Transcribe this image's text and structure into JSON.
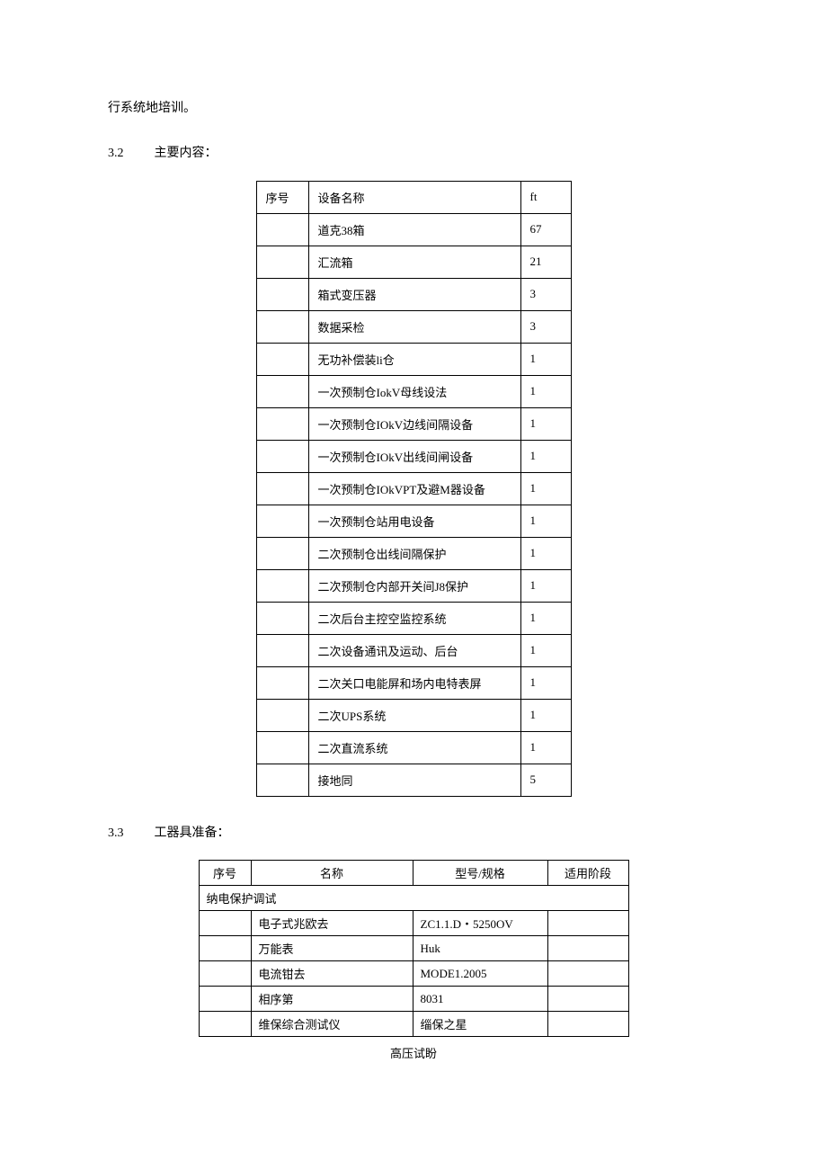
{
  "intro": "行系统地培训。",
  "section32": {
    "num": "3.2",
    "title": "主要内容："
  },
  "table1": {
    "headers": {
      "c1": "序号",
      "c2": "设备名称",
      "c3": "ft"
    },
    "rows": [
      {
        "c1": "",
        "c2": "道克38箱",
        "c3": "67"
      },
      {
        "c1": "",
        "c2": "汇流箱",
        "c3": "21"
      },
      {
        "c1": "",
        "c2": "箱式变压器",
        "c3": "3"
      },
      {
        "c1": "",
        "c2": "数据采检",
        "c3": "3"
      },
      {
        "c1": "",
        "c2": "无功补偿装li仓",
        "c3": "1"
      },
      {
        "c1": "",
        "c2": "一次预制仓IokV母线设法",
        "c3": "1"
      },
      {
        "c1": "",
        "c2": "一次预制仓IOkV边线间隔设备",
        "c3": "1"
      },
      {
        "c1": "",
        "c2": "一次预制仓IOkV出线间闸设备",
        "c3": "1"
      },
      {
        "c1": "",
        "c2": "一次预制仓IOkVPT及避M器设备",
        "c3": "1"
      },
      {
        "c1": "",
        "c2": "一次预制仓站用电设备",
        "c3": "1"
      },
      {
        "c1": "",
        "c2": "二次预制仓出线间隔保护",
        "c3": "1"
      },
      {
        "c1": "",
        "c2": "二次预制仓内部开关间J8保护",
        "c3": "1"
      },
      {
        "c1": "",
        "c2": "二次后台主控空监控系统",
        "c3": "1"
      },
      {
        "c1": "",
        "c2": "二次设备通讯及运动、后台",
        "c3": "1"
      },
      {
        "c1": "",
        "c2": "二次关口电能屏和场内电特表屏",
        "c3": "1"
      },
      {
        "c1": "",
        "c2": "二次UPS系统",
        "c3": "1"
      },
      {
        "c1": "",
        "c2": "二次直流系统",
        "c3": "1"
      },
      {
        "c1": "",
        "c2": "接地同",
        "c3": "5"
      }
    ]
  },
  "section33": {
    "num": "3.3",
    "title": "工器具准备："
  },
  "table2": {
    "headers": {
      "c1": "序号",
      "c2": "名称",
      "c3": "型号/规格",
      "c4": "适用阶段"
    },
    "group1": "纳电保护调试",
    "rows": [
      {
        "c1": "",
        "c2": "电子式兆欧去",
        "c3": "ZC1.1.D・5250OV",
        "c4": ""
      },
      {
        "c1": "",
        "c2": "万能表",
        "c3": "Huk",
        "c4": ""
      },
      {
        "c1": "",
        "c2": "电流钳去",
        "c3": "MODE1.2005",
        "c4": ""
      },
      {
        "c1": "",
        "c2": "相序第",
        "c3": "8031",
        "c4": ""
      },
      {
        "c1": "",
        "c2": "维保综合测试仪",
        "c3": "缁保之星",
        "c4": ""
      }
    ],
    "below": "高压试盼"
  }
}
